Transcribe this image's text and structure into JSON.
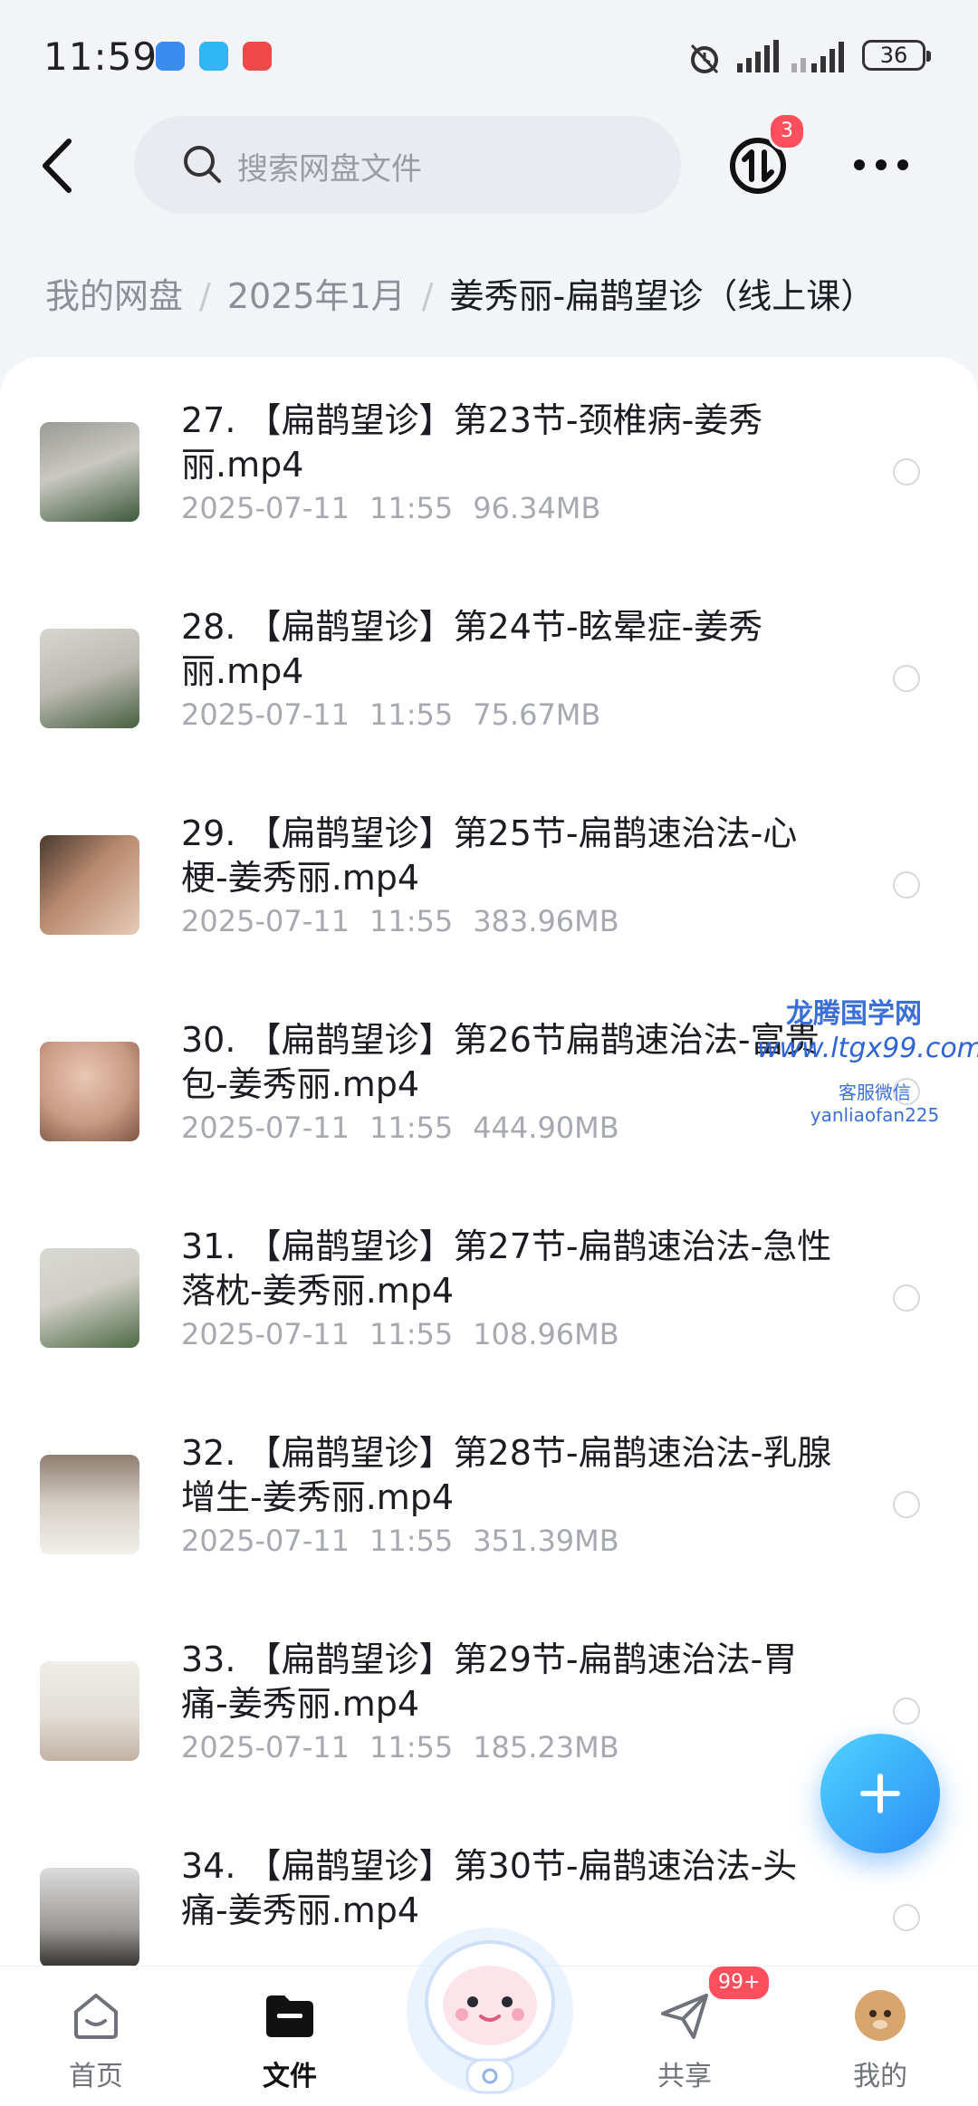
{
  "status_bar": {
    "time": "11:59",
    "signal": "signal-icon",
    "battery": "36"
  },
  "header": {
    "search_placeholder": "搜索网盘文件",
    "transfer_badge": "3"
  },
  "breadcrumb": {
    "items": [
      "我的网盘",
      "2025年1月",
      "姜秀丽-扁鹊望诊（线上课）"
    ]
  },
  "files": [
    {
      "name": "27. 【扁鹊望诊】第23节-颈椎病-姜秀丽.mp4",
      "date": "2025-07-11",
      "time": "11:55",
      "size": "96.34MB"
    },
    {
      "name": "28. 【扁鹊望诊】第24节-眩晕症-姜秀丽.mp4",
      "date": "2025-07-11",
      "time": "11:55",
      "size": "75.67MB"
    },
    {
      "name": "29. 【扁鹊望诊】第25节-扁鹊速治法-心梗-姜秀丽.mp4",
      "date": "2025-07-11",
      "time": "11:55",
      "size": "383.96MB"
    },
    {
      "name": "30. 【扁鹊望诊】第26节扁鹊速治法-富贵包-姜秀丽.mp4",
      "date": "2025-07-11",
      "time": "11:55",
      "size": "444.90MB"
    },
    {
      "name": "31. 【扁鹊望诊】第27节-扁鹊速治法-急性落枕-姜秀丽.mp4",
      "date": "2025-07-11",
      "time": "11:55",
      "size": "108.96MB"
    },
    {
      "name": "32. 【扁鹊望诊】第28节-扁鹊速治法-乳腺增生-姜秀丽.mp4",
      "date": "2025-07-11",
      "time": "11:55",
      "size": "351.39MB"
    },
    {
      "name": "33. 【扁鹊望诊】第29节-扁鹊速治法-胃痛-姜秀丽.mp4",
      "date": "2025-07-11",
      "time": "11:55",
      "size": "185.23MB"
    },
    {
      "name": "34. 【扁鹊望诊】第30节-扁鹊速治法-头痛-姜秀丽.mp4",
      "date": "",
      "time": "",
      "size": ""
    }
  ],
  "watermark": {
    "line1": "龙腾国学网",
    "line2": "www.ltgx99.com",
    "line3": "客服微信 yanliaofan225"
  },
  "tabbar": {
    "home": "首页",
    "files": "文件",
    "share": "共享",
    "share_badge": "99+",
    "mine": "我的"
  }
}
